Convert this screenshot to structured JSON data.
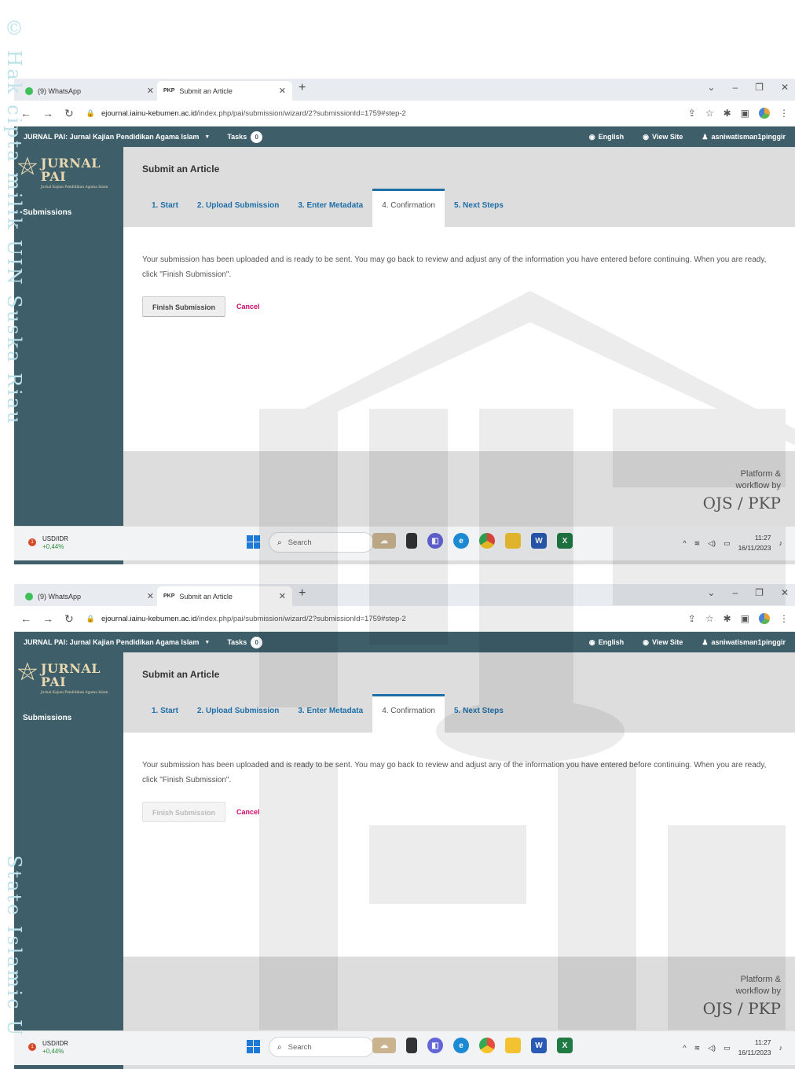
{
  "watermark": {
    "top_text": "© Hak cipta milik UIN Suska Riau",
    "bottom_text": "State Islamic U"
  },
  "browser": {
    "tabs": [
      {
        "label": "(9) WhatsApp"
      },
      {
        "label": "Submit an Article",
        "favicon": "PKP"
      }
    ],
    "url_host": "ejournal.iainu-kebumen.ac.id",
    "url_path": "/index.php/pai/submission/wizard/2?submissionId=1759#step-2"
  },
  "ojs": {
    "context": "JURNAL PAI: Jurnal Kajian Pendidikan Agama Islam",
    "tasks_label": "Tasks",
    "tasks_count": "0",
    "language": "English",
    "view_site": "View Site",
    "username": "asniwatisman1pinggir"
  },
  "sidebar": {
    "logo_name": "JURNAL PAI",
    "logo_tagline": "Jurnal Kajian Pendidikan Agama Islam",
    "submissions": "Submissions"
  },
  "page": {
    "title": "Submit an Article",
    "steps": [
      "1. Start",
      "2. Upload Submission",
      "3. Enter Metadata",
      "4. Confirmation",
      "5. Next Steps"
    ],
    "message": "Your submission has been uploaded and is ready to be sent. You may go back to review and adjust any of the information you have entered before continuing. When you are ready, click \"Finish Submission\".",
    "finish_button": "Finish Submission",
    "cancel_button": "Cancel"
  },
  "footer": {
    "line1": "Platform &",
    "line2": "workflow by",
    "brand": "OJS / PKP"
  },
  "taskbar": {
    "stock_name": "USD/IDR",
    "stock_change": "+0,44%",
    "stock_alert": "1",
    "search_placeholder": "Search",
    "time": "11:27",
    "date": "16/11/2023"
  },
  "colors": {
    "header": "#3e5f6a",
    "link": "#1e6ea7",
    "cancel": "#d00a6c",
    "watermark": "#bfe3ea"
  }
}
